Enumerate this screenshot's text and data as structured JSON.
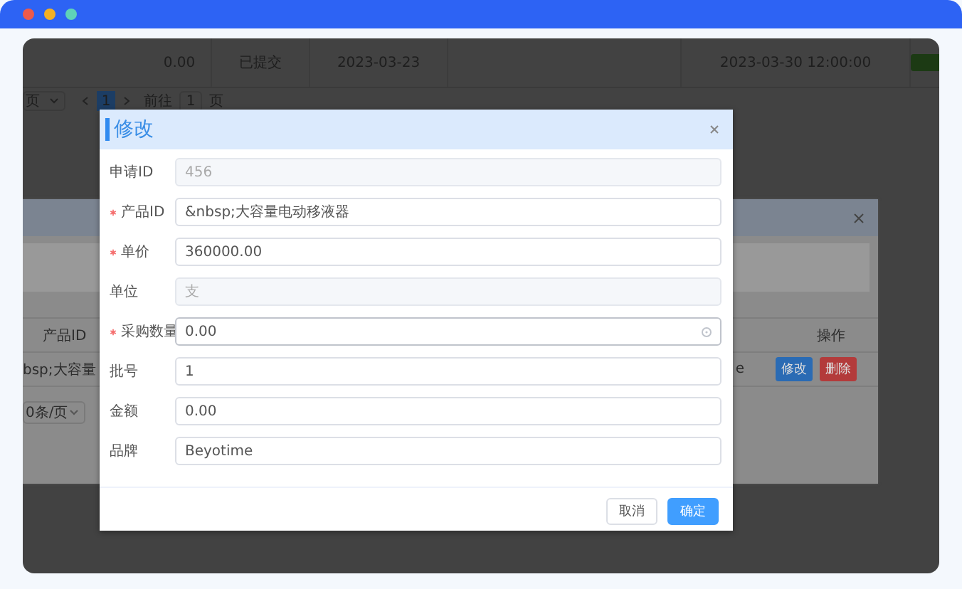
{
  "background_page": {
    "table_row": [
      "0.00",
      "已提交",
      "2023-03-23",
      "2023-03-30 12:00:00"
    ],
    "pagination": {
      "page_size": "页",
      "pages": [
        {
          "label": "1",
          "selected": true
        }
      ],
      "goto_label": "前往",
      "goto_value": "1",
      "goto_suffix": "页"
    }
  },
  "middle_dialog": {
    "columns": [
      "产品ID",
      "操作"
    ],
    "rows": [
      {
        "product_id": "bsp;大容量",
        "column_2": "e",
        "actions": [
          {
            "label": "修改",
            "kind": "primary"
          },
          {
            "label": "删除",
            "kind": "danger"
          }
        ]
      }
    ],
    "page_size": "0条/页"
  },
  "dialog": {
    "title": "修改",
    "fields": [
      {
        "label": "申请ID",
        "required": false,
        "value": "456",
        "disabled": true,
        "kind": "text"
      },
      {
        "label": "产品ID",
        "required": true,
        "value": "&nbsp;大容量电动移液器",
        "disabled": false,
        "kind": "text"
      },
      {
        "label": "单价",
        "required": true,
        "value": "360000.00",
        "disabled": false,
        "kind": "text"
      },
      {
        "label": "单位",
        "required": false,
        "value": "支",
        "disabled": true,
        "kind": "text"
      },
      {
        "label": "采购数量",
        "required": true,
        "value": "0.00",
        "disabled": false,
        "kind": "number"
      },
      {
        "label": "批号",
        "required": false,
        "value": "1",
        "disabled": false,
        "kind": "text"
      },
      {
        "label": "金额",
        "required": false,
        "value": "0.00",
        "disabled": false,
        "kind": "text"
      },
      {
        "label": "品牌",
        "required": false,
        "value": "Beyotime",
        "disabled": false,
        "kind": "text"
      }
    ],
    "buttons": [
      {
        "label": "取消",
        "kind": "default"
      },
      {
        "label": "确定",
        "kind": "primary"
      }
    ]
  }
}
